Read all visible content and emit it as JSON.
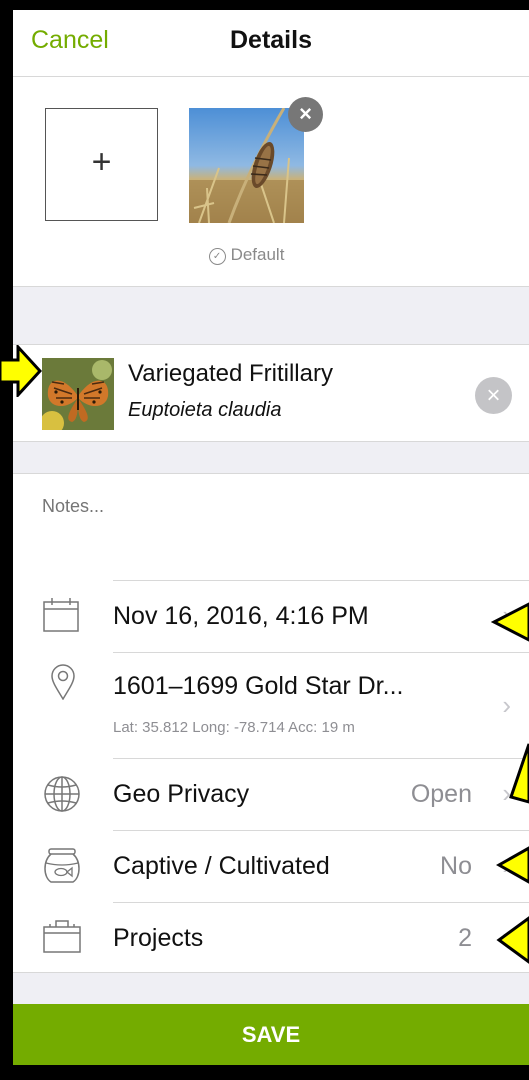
{
  "nav": {
    "cancel_label": "Cancel",
    "title": "Details"
  },
  "photos": {
    "add_symbol": "+",
    "default_label": "Default"
  },
  "taxon": {
    "common_name": "Variegated Fritillary",
    "scientific_name": "Euptoieta claudia"
  },
  "notes": {
    "placeholder": "Notes..."
  },
  "rows": {
    "date": {
      "label": "Nov 16, 2016, 4:16 PM",
      "icon": "calendar-icon"
    },
    "location": {
      "label": "1601–1699 Gold Star Dr...",
      "sub": "Lat: 35.812  Long: -78.714  Acc: 19 m",
      "icon": "location-pin-icon"
    },
    "geo_privacy": {
      "label": "Geo Privacy",
      "value": "Open",
      "icon": "globe-icon"
    },
    "captive": {
      "label": "Captive / Cultivated",
      "value": "No",
      "icon": "fishbowl-icon"
    },
    "projects": {
      "label": "Projects",
      "value": "2",
      "icon": "briefcase-icon"
    }
  },
  "save_label": "SAVE",
  "colors": {
    "accent": "#74ac00",
    "annotation": "#ffff00"
  }
}
